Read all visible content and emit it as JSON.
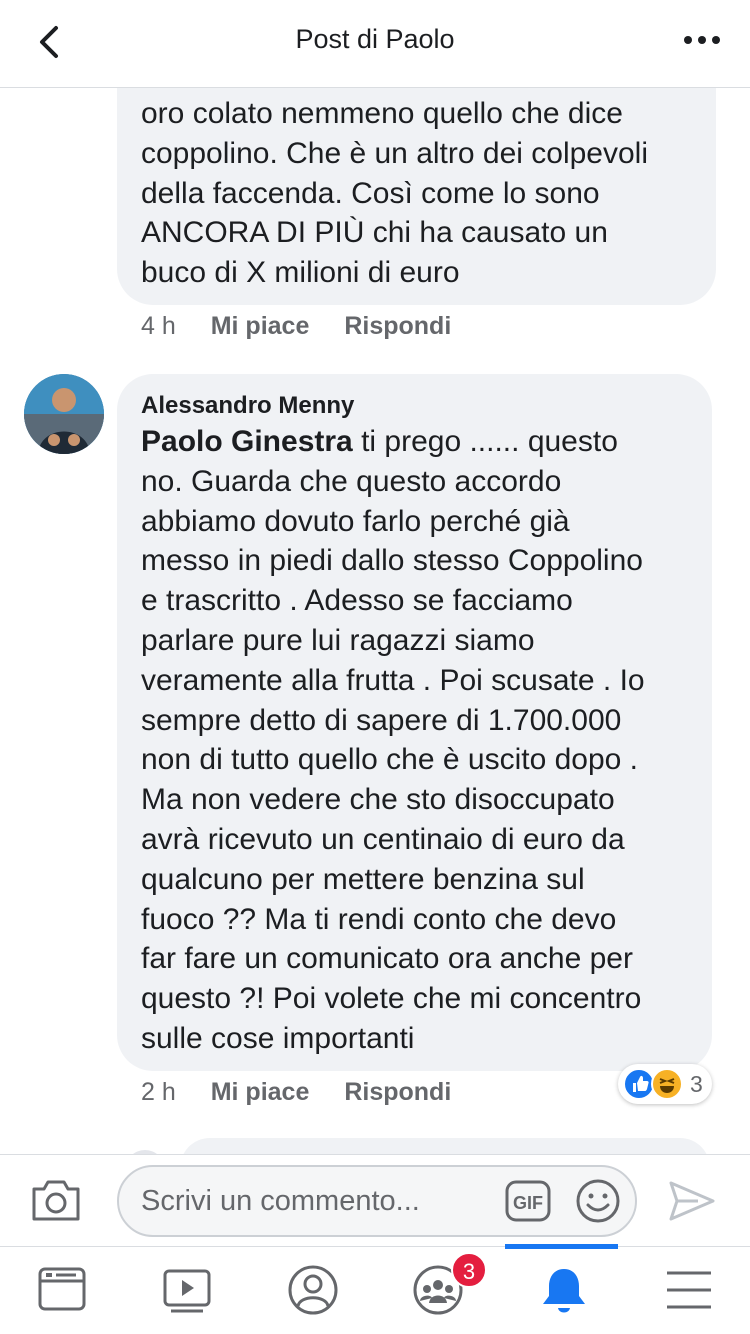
{
  "header": {
    "title": "Post di Paolo"
  },
  "comments": [
    {
      "text": "oro colato nemmeno quello che dice\ncoppolino. Che è un altro dei colpevoli\ndella  faccenda. Così come lo sono\nANCORA DI PIÙ  chi ha causato un\nbuco di X milioni di euro",
      "time": "4 h",
      "like_label": "Mi piace",
      "reply_label": "Rispondi"
    },
    {
      "author": "Alessandro Menny",
      "mention": "Paolo Ginestra",
      "text": " ti prego ...... questo\nno. Guarda che questo accordo\nabbiamo dovuto farlo perché già\nmesso in piedi dallo stesso Coppolino\ne trascritto . Adesso se facciamo\nparlare pure lui ragazzi siamo\nveramente alla frutta . Poi scusate . Io\nsempre detto di sapere di 1.700.000\nnon di tutto quello che è uscito dopo .\nMa non vedere che sto disoccupato\navrà ricevuto un centinaio di euro da\nqualcuno per mettere benzina sul\nfuoco ?? Ma ti rendi conto che devo\nfar fare un comunicato ora anche per\nquesto ?! Poi volete che mi concentro\nsulle cose importanti",
      "time": "2 h",
      "like_label": "Mi piace",
      "reply_label": "Rispondi",
      "reactions": {
        "icons": [
          "like-icon",
          "haha-icon"
        ],
        "count": "3"
      }
    }
  ],
  "composer": {
    "placeholder": "Scrivi un commento...",
    "gif_label": "GIF"
  },
  "tabbar": {
    "items": [
      "news-feed-icon",
      "watch-icon",
      "profile-icon",
      "groups-icon",
      "notifications-icon",
      "menu-icon"
    ],
    "active": "notifications-icon",
    "groups_badge": "3"
  },
  "colors": {
    "accent": "#1877f2",
    "bubble": "#f0f2f5",
    "badge": "#e41e3f",
    "secondary_text": "#65676b"
  }
}
